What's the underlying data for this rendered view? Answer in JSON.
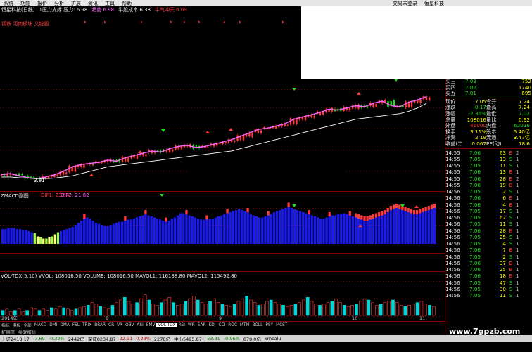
{
  "menu": {
    "items": [
      "系统",
      "功能",
      "报价",
      "分析",
      "扩展",
      "资讯",
      "工具",
      "帮助"
    ],
    "center": "交易未登录",
    "right": "恒星科技"
  },
  "info": {
    "title": "恒星科技(日线)",
    "support_text": "1压力支撑 压力: 6.98",
    "support_extra": "趋势 6.98",
    "cost": "牛股成本 6.38",
    "cost_extra": "牛气冲天 6.69",
    "second_line": "钢铁 河南板块 文统题"
  },
  "chart_data": [
    {
      "type": "line",
      "name": "main",
      "series": [
        {
          "name": "close",
          "color": "#ff66ff",
          "values": [
            4.05,
            4.1,
            4.0,
            3.92,
            3.88,
            3.95,
            4.05,
            4.2,
            4.4,
            4.5,
            4.55,
            4.6,
            4.7,
            4.65,
            4.8,
            4.9,
            5.0,
            5.1,
            5.05,
            5.2,
            5.3,
            5.35,
            5.25,
            5.3,
            5.4,
            5.5,
            5.6,
            5.75,
            5.9,
            6.05,
            6.1,
            6.2,
            6.3,
            6.5,
            6.6,
            6.7,
            6.8,
            6.95,
            6.9,
            7.0,
            7.1,
            7.05,
            7.2,
            7.3,
            7.1,
            7.05,
            7.25,
            7.35,
            7.5
          ]
        },
        {
          "name": "support",
          "color": "#ffffff",
          "values": [
            3.95,
            3.95,
            3.92,
            3.9,
            3.88,
            3.88,
            3.9,
            3.95,
            4.0,
            4.1,
            4.2,
            4.3,
            4.4,
            4.45,
            4.5,
            4.55,
            4.6,
            4.65,
            4.7,
            4.75,
            4.8,
            4.85,
            4.9,
            4.95,
            5.0,
            5.05,
            5.1,
            5.2,
            5.3,
            5.4,
            5.5,
            5.6,
            5.7,
            5.8,
            5.9,
            6.0,
            6.1,
            6.2,
            6.3,
            6.4,
            6.5,
            6.55,
            6.6,
            6.65,
            6.7,
            6.75,
            6.85,
            7.0,
            7.2
          ]
        }
      ],
      "annotation": "3.91",
      "yticks": [
        8.0,
        6.8,
        6.0,
        5.2,
        4.7
      ],
      "ylim": [
        3.7,
        8.6
      ]
    },
    {
      "type": "bar",
      "name": "macd",
      "values": [
        14,
        14,
        15,
        15,
        15,
        14,
        14,
        13,
        13,
        12,
        11,
        10,
        7,
        6,
        5,
        5,
        6,
        7,
        9,
        11,
        12,
        13,
        14,
        15,
        16,
        18,
        20,
        22,
        24,
        25,
        24,
        22,
        20,
        19,
        18,
        17,
        17,
        18,
        19,
        20,
        21,
        21,
        22,
        23,
        23,
        24,
        25,
        26,
        27,
        28,
        27,
        26,
        25,
        24,
        23,
        22,
        21,
        22,
        24,
        25,
        27,
        29,
        29,
        28,
        27,
        26,
        25,
        24,
        23,
        23,
        23,
        24,
        24,
        25,
        26,
        27,
        28,
        29,
        30,
        31,
        32,
        33,
        32,
        31,
        30,
        28,
        27,
        26,
        25,
        25,
        26,
        27,
        28,
        30,
        31,
        32,
        33,
        34,
        35,
        34,
        33,
        32,
        31,
        30,
        29,
        28,
        27,
        26,
        25,
        24,
        24,
        25,
        26,
        27,
        27,
        28,
        28,
        29,
        28,
        27,
        26,
        25,
        24,
        23,
        22,
        22,
        23,
        24,
        25,
        26,
        27,
        28,
        30,
        32,
        33,
        34,
        33,
        32,
        31,
        30,
        29,
        28,
        28,
        29,
        30,
        31,
        32,
        33,
        34
      ],
      "legend": [
        "DIF1: 23.54",
        "DIF2: 21.82"
      ],
      "yticks": [
        "20.00",
        "10.00"
      ],
      "ylim": [
        0,
        40
      ]
    },
    {
      "type": "bar",
      "name": "volume",
      "values": [
        4,
        5,
        3,
        4,
        5,
        3,
        4,
        6,
        5,
        4,
        5,
        4,
        6,
        5,
        7,
        6,
        5,
        4,
        5,
        6,
        7,
        8,
        10,
        9,
        7,
        6,
        5,
        8,
        10,
        12,
        14,
        11,
        9,
        10,
        13,
        16,
        12,
        9,
        8,
        10,
        12,
        14,
        10,
        8,
        9,
        11,
        13,
        15,
        12,
        10,
        9,
        11,
        13,
        10,
        9,
        8,
        7,
        9,
        11,
        13,
        15,
        12,
        10,
        8,
        9,
        11,
        12,
        10,
        9,
        8,
        7,
        8,
        9,
        10,
        12,
        14,
        11,
        9,
        8,
        9,
        10,
        11,
        13,
        10,
        8,
        7,
        8,
        9,
        11,
        13,
        12,
        10,
        8,
        9,
        10,
        11,
        12,
        10,
        8,
        7,
        8,
        9,
        10,
        11,
        9,
        8,
        7
      ],
      "legend": "VOL-TDX(5,10) VVOL: 108016.50  VOLUME: 108016.50  MAVOL1: 116188.80  MAVOL2: 115492.80",
      "yticks": [
        "30000",
        "20000",
        "10000"
      ],
      "ylim": [
        0,
        30
      ]
    }
  ],
  "quotes": {
    "asks": [
      {
        "label": "买三",
        "price": "7.03",
        "vol": "752"
      },
      {
        "label": "买四",
        "price": "7.02",
        "vol": "1740"
      },
      {
        "label": "买五",
        "price": "7.01",
        "vol": "695"
      }
    ],
    "stats": [
      {
        "l1": "现价",
        "v1": "7.05",
        "l2": "今开",
        "v2": "7.24"
      },
      {
        "l1": "涨跌",
        "v1": "-0.17",
        "l2": "最高",
        "v2": "7.24"
      },
      {
        "l1": "涨幅",
        "v1": "-2.35%",
        "l2": "最低",
        "v2": "7.02"
      },
      {
        "l1": "总量",
        "v1": "108016",
        "l2": "量比",
        "v2": "0.92"
      },
      {
        "l1": "外盘",
        "v1": "46000",
        "l2": "内盘",
        "v2": "62016"
      },
      {
        "l1": "换手",
        "v1": "3.11%",
        "l2": "股本",
        "v2": "5.40亿"
      },
      {
        "l1": "净资",
        "v1": "2.19",
        "l2": "流通",
        "v2": "3.47亿"
      },
      {
        "l1": "收益(二)",
        "v1": "0.067",
        "l2": "PE(动)",
        "v2": "78.6"
      }
    ],
    "ticks": [
      {
        "t": "14:55",
        "p": "7.06",
        "v": "63",
        "s": "B",
        "n": "2"
      },
      {
        "t": "14:55",
        "p": "7.05",
        "v": "13",
        "s": "S",
        "n": "1"
      },
      {
        "t": "14:55",
        "p": "7.05",
        "v": "11",
        "s": "S",
        "n": "1"
      },
      {
        "t": "14:55",
        "p": "7.06",
        "v": "13",
        "s": "B",
        "n": "1"
      },
      {
        "t": "14:55",
        "p": "7.06",
        "v": "28",
        "s": "B",
        "n": "2"
      },
      {
        "t": "14:55",
        "p": "7.06",
        "v": "19",
        "s": "B",
        "n": "1"
      },
      {
        "t": "14:56",
        "p": "7.05",
        "v": "2",
        "s": "S",
        "n": "1"
      },
      {
        "t": "14:56",
        "p": "7.06",
        "v": "6",
        "s": "B",
        "n": "1"
      },
      {
        "t": "14:56",
        "p": "7.06",
        "v": "4",
        "s": "B",
        "n": "1"
      },
      {
        "t": "14:56",
        "p": "7.05",
        "v": "17",
        "s": "S",
        "n": "1"
      },
      {
        "t": "14:56",
        "p": "7.05",
        "v": "62",
        "s": "S",
        "n": "1"
      },
      {
        "t": "14:56",
        "p": "7.05",
        "v": "11",
        "s": "S",
        "n": "1"
      },
      {
        "t": "14:56",
        "p": "7.06",
        "v": "28",
        "s": "B",
        "n": "1"
      },
      {
        "t": "14:56",
        "p": "7.05",
        "v": "25",
        "s": "S",
        "n": "1"
      },
      {
        "t": "14:56",
        "p": "7.05",
        "v": "4",
        "s": "S",
        "n": "1"
      },
      {
        "t": "14:56",
        "p": "7.06",
        "v": "7",
        "s": "B",
        "n": "1"
      },
      {
        "t": "14:56",
        "p": "7.05",
        "v": "2",
        "s": "S",
        "n": "1"
      },
      {
        "t": "14:56",
        "p": "7.06",
        "v": "37",
        "s": "B",
        "n": "1"
      },
      {
        "t": "14:56",
        "p": "7.06",
        "v": "25",
        "s": "B",
        "n": "1"
      },
      {
        "t": "14:56",
        "p": "7.06",
        "v": "18",
        "s": "B",
        "n": "1"
      },
      {
        "t": "14:56",
        "p": "7.05",
        "v": "47",
        "s": "S",
        "n": "1"
      },
      {
        "t": "14:56",
        "p": "7.05",
        "v": "30",
        "s": "S",
        "n": "1"
      },
      {
        "t": "14:56",
        "p": "7.05",
        "v": "11",
        "s": "S",
        "n": "1"
      }
    ]
  },
  "tabs": [
    "指标",
    "模板",
    "全部",
    "MACD",
    "DMI",
    "DMA",
    "FSL",
    "TRIX",
    "BRAR",
    "CR",
    "VR",
    "OBV",
    "ASI",
    "EMV",
    "VOL-TDX",
    "RSI",
    "WR",
    "SAR",
    "KDJ",
    "CCI",
    "ROC",
    "MTM",
    "BOLL",
    "PSY",
    "MCST"
  ],
  "active_tab": "VOL-TDX",
  "subtabs": [
    "扩展区",
    "关联报价"
  ],
  "status": {
    "sh": "上证2418.17",
    "sh_chg": "-7.69",
    "sh_pct": "-0.32%",
    "sh_amt": "2442亿",
    "sz": "深证8234.87",
    "sz_chg": "22.91",
    "sz_pct": "0.28%",
    "sz_amt": "2278亿",
    "zx": "中小5495.87",
    "zx_chg": "-53.31",
    "zx_pct": "-0.96%",
    "zx_amt": "870.0亿",
    "ver": "kmcalu"
  },
  "watermark": "www.7gpzb.com",
  "x_labels": [
    "2014年",
    "8",
    "9",
    "10",
    "11"
  ],
  "colors": {
    "up": "#ff3b3b",
    "down": "#1ee01e",
    "macd_bar": "#1a1aee",
    "grid": "#800000"
  }
}
